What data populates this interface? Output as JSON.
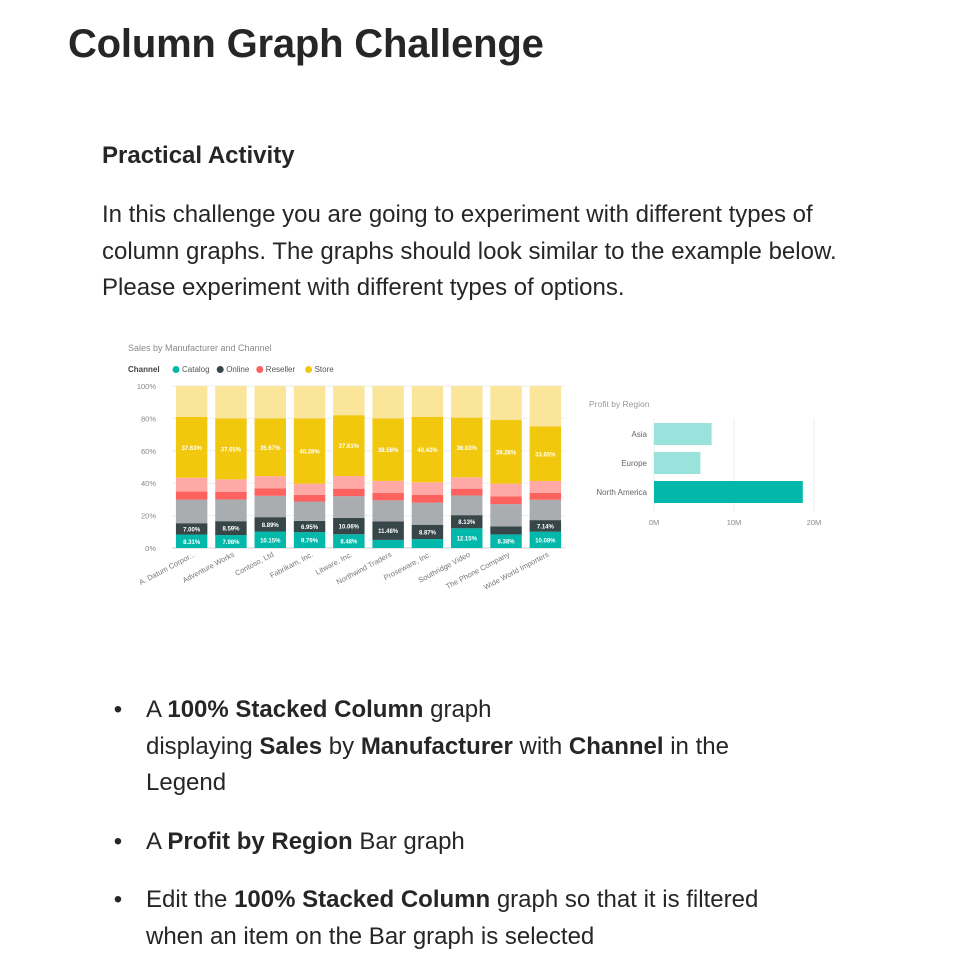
{
  "title": "Column Graph Challenge",
  "heading": "Practical Activity",
  "intro": "In this challenge you are going to experiment with different types of column graphs.  The graphs should look similar to the example below. Please experiment with different types of options.",
  "chart_data": [
    {
      "type": "bar",
      "stacked": "100%",
      "title": "Sales by Manufacturer and Channel",
      "legend_title": "Channel",
      "legend_position": "top-left",
      "categories": [
        "A. Datum Corpor...",
        "Adventure Works",
        "Contoso, Ltd",
        "Fabrikam, Inc.",
        "Litware, Inc.",
        "Northwind Traders",
        "Proseware, Inc.",
        "Southridge Video",
        "The Phone Company",
        "Wide World Importers"
      ],
      "yticks": [
        "0%",
        "20%",
        "40%",
        "60%",
        "80%",
        "100%"
      ],
      "ylim": [
        0,
        100
      ],
      "series": [
        {
          "name": "Catalog",
          "color": "#01b8aa",
          "values": [
            8.31,
            7.98,
            10.15,
            9.79,
            8.48,
            5.0,
            5.5,
            12.15,
            8.38,
            10.08
          ],
          "labels": [
            "8.31%",
            "7.98%",
            "10.15%",
            "9.79%",
            "8.48%",
            "",
            "",
            "12.15%",
            "8.38%",
            "10.08%"
          ]
        },
        {
          "name": "Online",
          "color": "#374649",
          "values": [
            7.0,
            8.59,
            8.89,
            6.95,
            10.06,
            11.48,
            8.87,
            8.13,
            5.0,
            7.14
          ],
          "labels": [
            "7.00%",
            "8.59%",
            "8.89%",
            "6.95%",
            "10.06%",
            "11.48%",
            "8.87%",
            "8.13%",
            "",
            "7.14%"
          ]
        },
        {
          "name": "Reseller",
          "color": "#fd625e",
          "values": [
            28.06,
            25.78,
            25.29,
            22.98,
            25.85,
            24.94,
            26.21,
            23.36,
            26.36,
            24.13
          ],
          "labels": []
        },
        {
          "name": "Store",
          "color": "#f2c80f",
          "values": [
            37.63,
            37.65,
            35.67,
            40.28,
            37.61,
            38.58,
            40.42,
            36.83,
            39.26,
            33.65
          ],
          "labels": [
            "37.63%",
            "37.65%",
            "35.67%",
            "40.28%",
            "37.61%",
            "38.58%",
            "40.42%",
            "36.83%",
            "39.26%",
            "33.65%"
          ]
        }
      ]
    },
    {
      "type": "bar",
      "orientation": "horizontal",
      "title": "Profit by Region",
      "categories": [
        "Asia",
        "Europe",
        "North America"
      ],
      "values": [
        7.2,
        5.8,
        18.6
      ],
      "colors": [
        "#9ae2dc",
        "#9ae2dc",
        "#01b8aa"
      ],
      "xticks": [
        "0M",
        "10M",
        "20M"
      ],
      "xlim": [
        0,
        20
      ]
    }
  ],
  "bullets": [
    [
      {
        "t": "A "
      },
      {
        "t": "100% Stacked Column",
        "b": true
      },
      {
        "t": " graph"
      }
    ],
    [
      {
        "t": "displaying "
      },
      {
        "t": "Sales",
        "b": true
      },
      {
        "t": " by "
      },
      {
        "t": "Manufacturer",
        "b": true
      },
      {
        "t": " with "
      },
      {
        "t": "Channel",
        "b": true
      },
      {
        "t": " in the"
      }
    ],
    [
      {
        "t": "Legend"
      }
    ],
    [
      {
        "t": "A "
      },
      {
        "t": "Profit by Region",
        "b": true
      },
      {
        "t": " Bar graph"
      }
    ],
    [
      {
        "t": "Edit the "
      },
      {
        "t": "100% Stacked Column",
        "b": true
      },
      {
        "t": " graph so that it is filtered"
      }
    ],
    [
      {
        "t": "when an item on the Bar graph is selected"
      }
    ]
  ],
  "bullet_groups": [
    [
      0,
      1,
      2
    ],
    [
      3
    ],
    [
      4,
      5
    ]
  ]
}
